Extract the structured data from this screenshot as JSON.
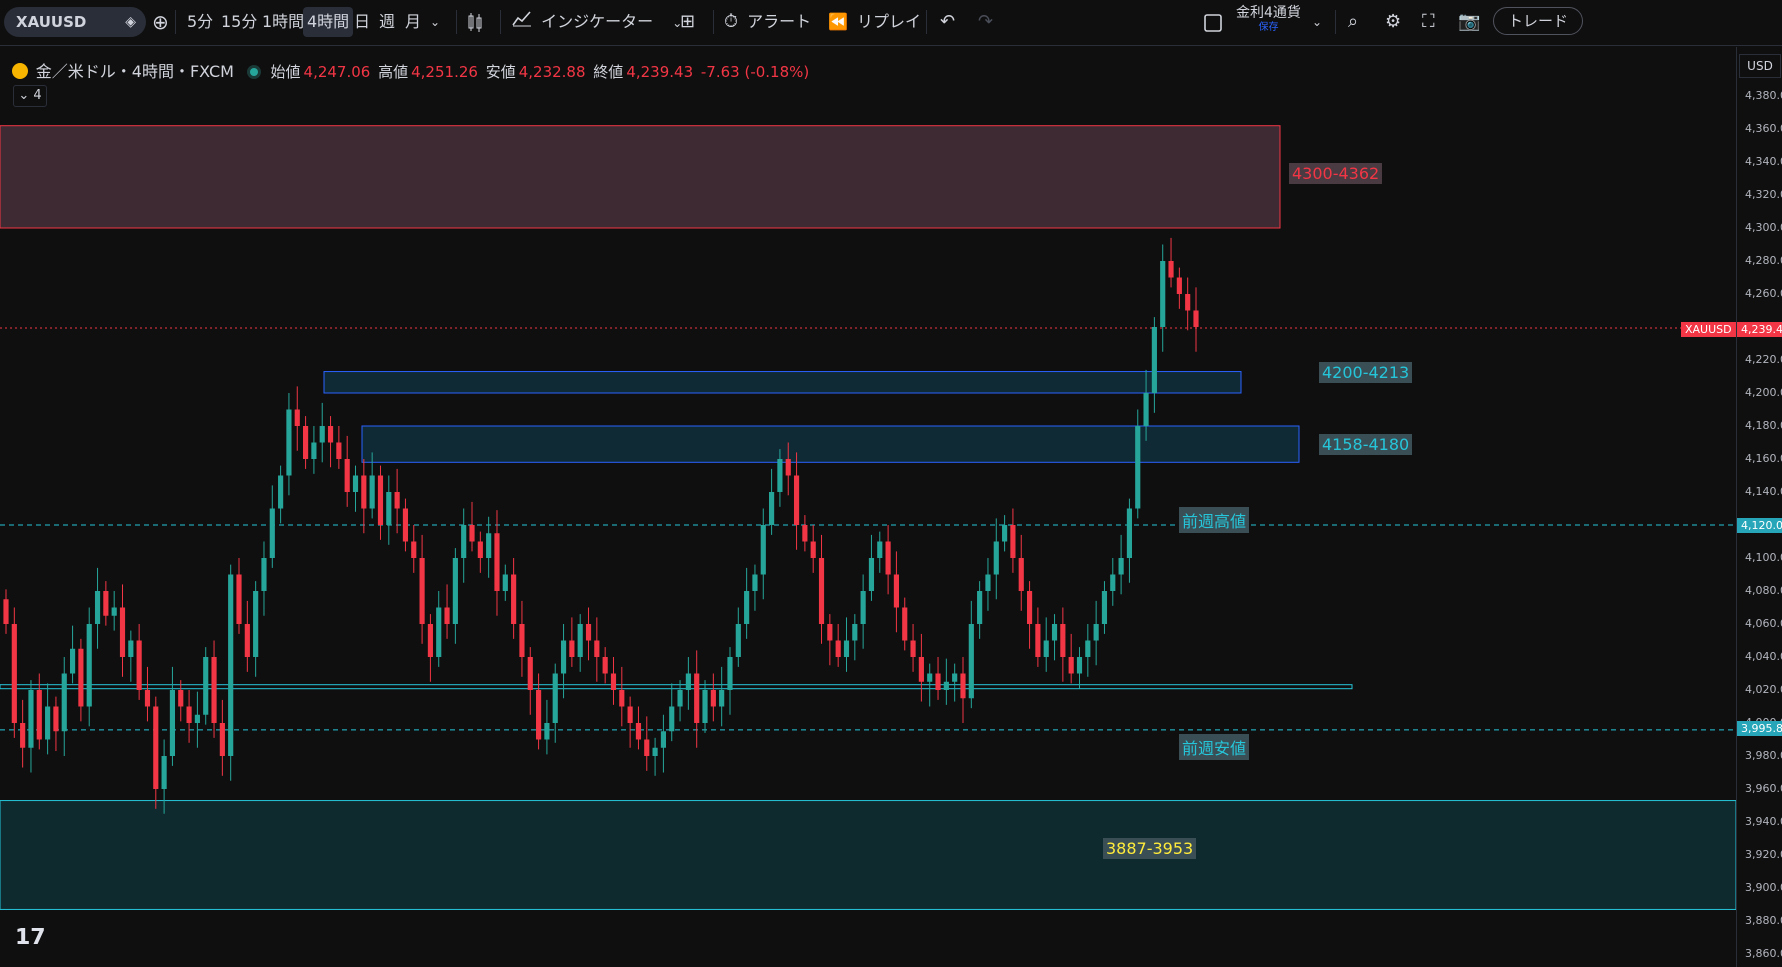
{
  "toolbar": {
    "symbol": "XAUUSD",
    "timeframes": [
      "5分",
      "15分",
      "1時間",
      "4時間",
      "日",
      "週",
      "月"
    ],
    "active_timeframe": "4時間",
    "indicators_label": "インジケーター",
    "alert_label": "アラート",
    "replay_label": "リプレイ",
    "layout_name": "金利4通貨",
    "layout_status": "保存",
    "trade_label": "トレード"
  },
  "legend": {
    "title": "金／米ドル・4時間・FXCM",
    "open_label": "始値",
    "open": "4,247.06",
    "high_label": "高値",
    "high": "4,251.26",
    "low_label": "安値",
    "low": "4,232.88",
    "close_label": "終値",
    "close": "4,239.43",
    "change": "-7.63 (-0.18%)",
    "collapse": "4"
  },
  "axis": {
    "currency": "USD",
    "ticks": [
      4380,
      4360,
      4340,
      4320,
      4300,
      4280,
      4260,
      4240,
      4220,
      4200,
      4180,
      4160,
      4140,
      4120,
      4100,
      4080,
      4060,
      4040,
      4020,
      4000,
      3980,
      3960,
      3940,
      3920,
      3900,
      3880,
      3860
    ],
    "price_tag_symbol": "XAUUSD",
    "price_tag_value": "4,239.4",
    "prev_high_tag": "4,120.0",
    "prev_low_tag": "3,995.8"
  },
  "zones": {
    "resistance_label": "4300-4362",
    "support1_label": "4200-4213",
    "support2_label": "4158-4180",
    "prev_week_high_label": "前週高値",
    "prev_week_low_label": "前週安値",
    "bottom_zone_label": "3887-3953"
  },
  "colors": {
    "up": "#26a69a",
    "down": "#f23645",
    "resistance_fill": "#3d2a33",
    "resistance_border": "#f23645",
    "support_fill": "#0f2a35",
    "support_border": "#2962ff",
    "teal_line": "#26c6da",
    "bottom_fill": "#0f2a2e",
    "label_yellow": "#ffeb3b"
  },
  "chart_data": {
    "type": "candlestick",
    "symbol": "XAUUSD",
    "timeframe": "4時間",
    "ylim": [
      3860,
      4390
    ],
    "last_price": 4239.43,
    "zones": [
      {
        "label": "4300-4362",
        "low": 4300,
        "high": 4362
      },
      {
        "label": "4200-4213",
        "low": 4200,
        "high": 4213
      },
      {
        "label": "4158-4180",
        "low": 4158,
        "high": 4180
      },
      {
        "label": "3887-3953",
        "low": 3887,
        "high": 3953
      }
    ],
    "lines": [
      {
        "label": "前週高値",
        "value": 4120
      },
      {
        "label": "前週安値",
        "value": 3995.8
      },
      {
        "label": "",
        "value": 4022
      }
    ],
    "closes": [
      4060,
      4000,
      3985,
      4020,
      3990,
      4010,
      3995,
      4030,
      4045,
      4010,
      4060,
      4080,
      4065,
      4070,
      4040,
      4050,
      4020,
      4010,
      3960,
      3980,
      4020,
      4010,
      4000,
      4005,
      4040,
      4000,
      3980,
      4090,
      4060,
      4040,
      4080,
      4100,
      4130,
      4150,
      4190,
      4180,
      4160,
      4170,
      4180,
      4170,
      4160,
      4140,
      4150,
      4130,
      4150,
      4120,
      4140,
      4130,
      4110,
      4100,
      4060,
      4040,
      4070,
      4060,
      4100,
      4120,
      4110,
      4100,
      4115,
      4080,
      4090,
      4060,
      4040,
      4020,
      3990,
      4000,
      4030,
      4050,
      4040,
      4060,
      4050,
      4040,
      4030,
      4020,
      4010,
      4000,
      3990,
      3980,
      3985,
      3995,
      4010,
      4020,
      4030,
      4000,
      4020,
      4010,
      4020,
      4040,
      4060,
      4080,
      4090,
      4120,
      4140,
      4160,
      4150,
      4120,
      4110,
      4100,
      4060,
      4050,
      4040,
      4050,
      4060,
      4080,
      4100,
      4110,
      4090,
      4070,
      4050,
      4040,
      4025,
      4030,
      4020,
      4025,
      4030,
      4015,
      4060,
      4080,
      4090,
      4110,
      4120,
      4100,
      4080,
      4060,
      4040,
      4050,
      4060,
      4040,
      4030,
      4040,
      4050,
      4060,
      4080,
      4090,
      4100,
      4130,
      4180,
      4200,
      4240,
      4280,
      4270,
      4260,
      4250,
      4240
    ]
  }
}
